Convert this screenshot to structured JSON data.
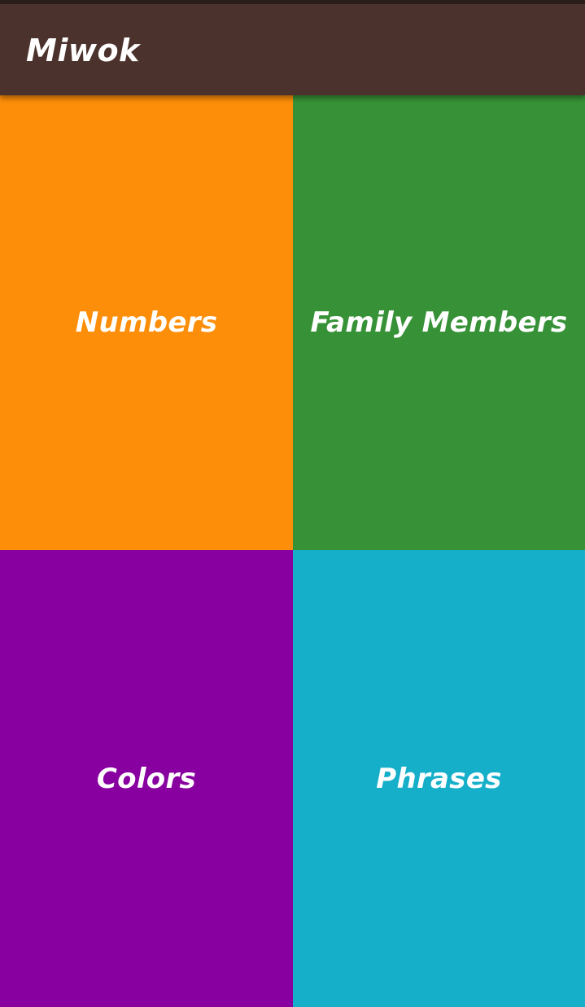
{
  "app_bar": {
    "title": "Miwok",
    "color": "#4c322c"
  },
  "categories": [
    {
      "label": "Numbers",
      "color": "#fd8e09"
    },
    {
      "label": "Family Members",
      "color": "#379237"
    },
    {
      "label": "Colors",
      "color": "#8800a0"
    },
    {
      "label": "Phrases",
      "color": "#16afca"
    }
  ]
}
